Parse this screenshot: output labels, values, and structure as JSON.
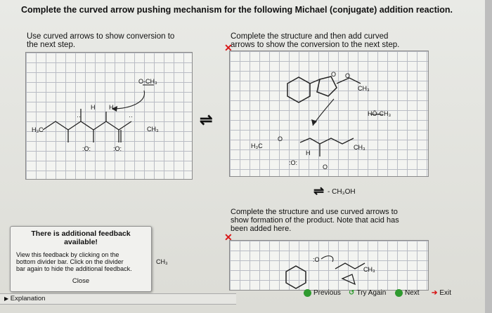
{
  "question": {
    "title": "Complete the curved arrow pushing mechanism for the following Michael (conjugate) addition reaction."
  },
  "left_panel": {
    "instruction": [
      "Use curved arrows to show conversion to",
      "the next step."
    ]
  },
  "right_panel": {
    "instruction": [
      "Complete the structure and then add curved",
      "arrows to show the conversion to the next step."
    ]
  },
  "lower_panel": {
    "instruction": [
      "Complete the structure and use curved arrows to",
      "show formation of the product. Note that acid has",
      "been added here."
    ]
  },
  "left_molecule": {
    "o_methyl": "O-CH₃",
    "h1": "H",
    "h2": "H",
    "h3c": "H₃C",
    "ch3": "CH₃",
    "o_a": ":O:",
    "o_b": ":O:",
    "dots_a": "··",
    "dots_b": "··"
  },
  "right_molecule": {
    "ch3_top": "CH₃",
    "o_top1": "O",
    "o_top2": "O",
    "hoch3": "HÖ-CH₃",
    "h3c": "H₃C",
    "h": "H",
    "o_mid": "O",
    "ch3_mid": "CH₃",
    "o_bottom": ":O:",
    "o_single": "O"
  },
  "lower_molecule": {
    "o_partial": ":O",
    "ch3": "CH₃"
  },
  "reagent": {
    "text": "- CH₃OH"
  },
  "equilibrium_glyph": "⇌",
  "feedback": {
    "title_line1": "There is additional feedback",
    "title_line2": "available!",
    "body": [
      "View this feedback by clicking on the",
      "bottom divider bar. Click on the divider",
      "bar again to hide the additional feedback."
    ],
    "behind_label": "CH₃",
    "close": "Close"
  },
  "explanation": "Explanation",
  "nav": {
    "previous": "Previous",
    "try_again": "Try Again",
    "next": "Next",
    "exit": "Exit"
  },
  "colors": {
    "red_x": "#d81818",
    "green": "#2f9a2f",
    "grid_line": "#b9bcc4"
  }
}
